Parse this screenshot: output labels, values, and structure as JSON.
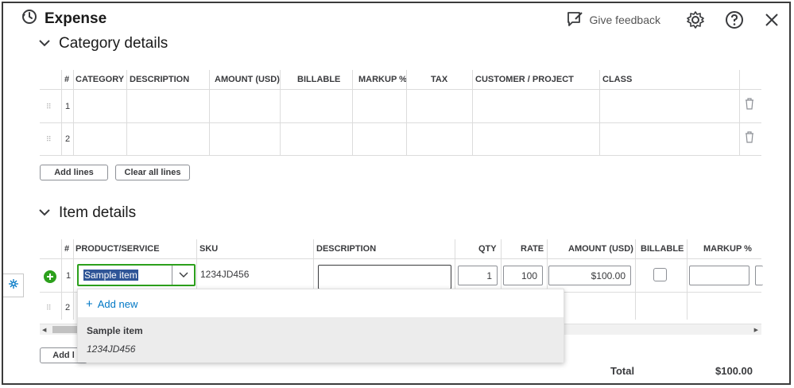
{
  "header": {
    "title": "Expense",
    "feedback_label": "Give feedback"
  },
  "category": {
    "title": "Category details",
    "columns": [
      "#",
      "CATEGORY",
      "DESCRIPTION",
      "AMOUNT (USD)",
      "BILLABLE",
      "MARKUP %",
      "TAX",
      "CUSTOMER / PROJECT",
      "CLASS"
    ],
    "rows": [
      {
        "num": "1"
      },
      {
        "num": "2"
      }
    ],
    "add_lines_label": "Add lines",
    "clear_lines_label": "Clear all lines"
  },
  "items": {
    "title": "Item details",
    "columns": [
      "#",
      "PRODUCT/SERVICE",
      "SKU",
      "DESCRIPTION",
      "QTY",
      "RATE",
      "AMOUNT (USD)",
      "BILLABLE",
      "MARKUP %"
    ],
    "row1": {
      "num": "1",
      "product": "Sample item",
      "sku": "1234JD456",
      "description": "",
      "qty": "1",
      "rate": "100",
      "amount": "$100.00",
      "billable": false
    },
    "row2": {
      "num": "2"
    },
    "add_lines_label": "Add l"
  },
  "dropdown": {
    "add_new_label": "Add new",
    "option_name": "Sample item",
    "option_sku": "1234JD456"
  },
  "total": {
    "label": "Total",
    "value": "$100.00"
  },
  "colors": {
    "accent_green": "#2ca01c",
    "link_blue": "#0077c5",
    "selection": "#2f5597"
  }
}
